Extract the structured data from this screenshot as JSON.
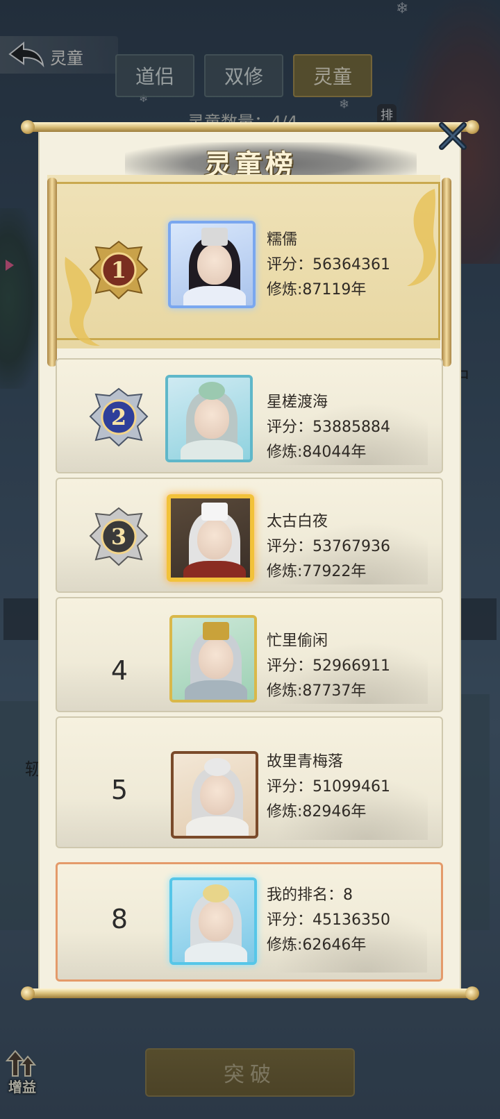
{
  "header": {
    "back_title": "灵童",
    "tabs": [
      {
        "label": "道侣",
        "active": false
      },
      {
        "label": "双修",
        "active": false
      },
      {
        "label": "灵童",
        "active": true
      }
    ],
    "count_text": "灵童数量：4/4",
    "side_rank_glyph": "排"
  },
  "side": {
    "right_glyph": "中",
    "left_glyph": "轫"
  },
  "panel": {
    "title": "灵童榜",
    "close_icon": "close-x-icon",
    "score_label": "评分：",
    "train_label": "修炼:",
    "year_suffix": "年"
  },
  "leaderboard": [
    {
      "rank": "1",
      "name": "糯儒",
      "score": "评分：56364361",
      "train": "修炼:87119年"
    },
    {
      "rank": "2",
      "name": "星槎渡海",
      "score": "评分：53885884",
      "train": "修炼:84044年"
    },
    {
      "rank": "3",
      "name": "太古白夜",
      "score": "评分：53767936",
      "train": "修炼:77922年"
    },
    {
      "rank": "4",
      "name": "忙里偷闲",
      "score": "评分：52966911",
      "train": "修炼:87737年"
    },
    {
      "rank": "5",
      "name": "故里青梅落",
      "score": "评分：51099461",
      "train": "修炼:82946年"
    }
  ],
  "my_rank": {
    "rank": "8",
    "label": "我的排名：8",
    "score": "评分：45136350",
    "train": "修炼:62646年"
  },
  "footer": {
    "boost_label": "增益",
    "breakthrough_label": "突破"
  },
  "colors": {
    "accent_gold": "#c9a94f",
    "highlight_border": "#e49a6a",
    "medal_gold": "#d4a63a",
    "medal_blue": "#2e3f9a",
    "medal_dark": "#3a3a3a"
  }
}
